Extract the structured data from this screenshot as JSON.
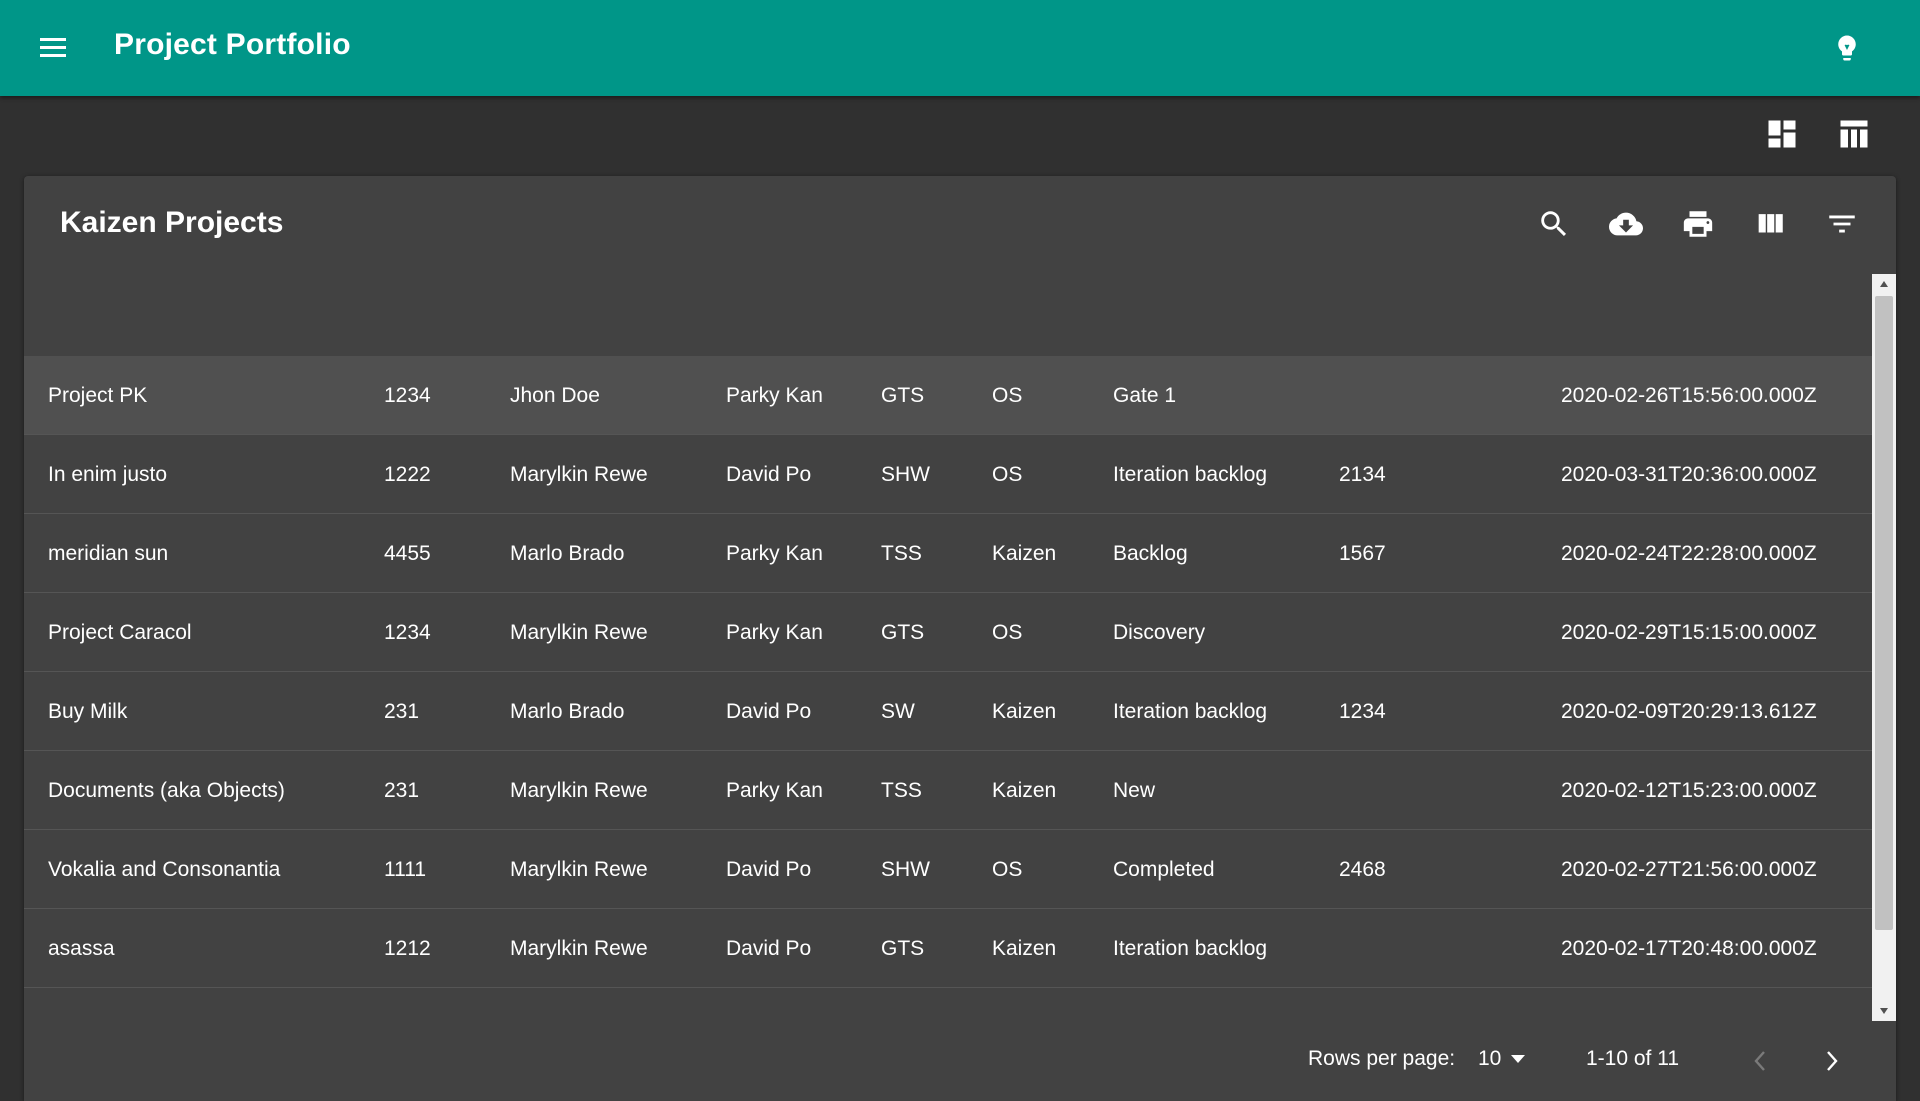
{
  "app": {
    "title": "Project Portfolio",
    "theme_color": "#009688"
  },
  "icons": {
    "menu": "menu-icon",
    "theme": "lightbulb-icon",
    "dashboard_view": "dashboard-icon",
    "table_view": "table-view-icon",
    "search": "search-icon",
    "download": "cloud-download-icon",
    "print": "print-icon",
    "columns": "view-column-icon",
    "filter": "filter-list-icon"
  },
  "table": {
    "title": "Kaizen Projects",
    "rows": [
      {
        "name": "Project PK",
        "id": "1234",
        "owner": "Jhon Doe",
        "sponsor": "Parky Kan",
        "unit": "GTS",
        "type": "OS",
        "stage": "Gate 1",
        "number": "",
        "date": "2020-02-26T15:56:00.000Z"
      },
      {
        "name": "In enim justo",
        "id": "1222",
        "owner": "Marylkin Rewe",
        "sponsor": "David Po",
        "unit": "SHW",
        "type": "OS",
        "stage": "Iteration backlog",
        "number": "2134",
        "date": "2020-03-31T20:36:00.000Z"
      },
      {
        "name": "meridian sun",
        "id": "4455",
        "owner": "Marlo Brado",
        "sponsor": "Parky Kan",
        "unit": "TSS",
        "type": "Kaizen",
        "stage": "Backlog",
        "number": "1567",
        "date": "2020-02-24T22:28:00.000Z"
      },
      {
        "name": "Project Caracol",
        "id": "1234",
        "owner": "Marylkin Rewe",
        "sponsor": "Parky Kan",
        "unit": "GTS",
        "type": "OS",
        "stage": "Discovery",
        "number": "",
        "date": "2020-02-29T15:15:00.000Z"
      },
      {
        "name": "Buy Milk",
        "id": "231",
        "owner": "Marlo Brado",
        "sponsor": "David Po",
        "unit": "SW",
        "type": "Kaizen",
        "stage": "Iteration backlog",
        "number": "1234",
        "date": "2020-02-09T20:29:13.612Z"
      },
      {
        "name": "Documents (aka Objects)",
        "id": "231",
        "owner": "Marylkin Rewe",
        "sponsor": "Parky Kan",
        "unit": "TSS",
        "type": "Kaizen",
        "stage": "New",
        "number": "",
        "date": "2020-02-12T15:23:00.000Z"
      },
      {
        "name": "Vokalia and Consonantia",
        "id": "1111",
        "owner": "Marylkin Rewe",
        "sponsor": "David Po",
        "unit": "SHW",
        "type": "OS",
        "stage": "Completed",
        "number": "2468",
        "date": "2020-02-27T21:56:00.000Z"
      },
      {
        "name": "asassa",
        "id": "1212",
        "owner": "Marylkin Rewe",
        "sponsor": "David Po",
        "unit": "GTS",
        "type": "Kaizen",
        "stage": "Iteration backlog",
        "number": "",
        "date": "2020-02-17T20:48:00.000Z"
      }
    ]
  },
  "pagination": {
    "rows_per_page_label": "Rows per page:",
    "rows_per_page_value": "10",
    "range": "1-10 of 11"
  }
}
